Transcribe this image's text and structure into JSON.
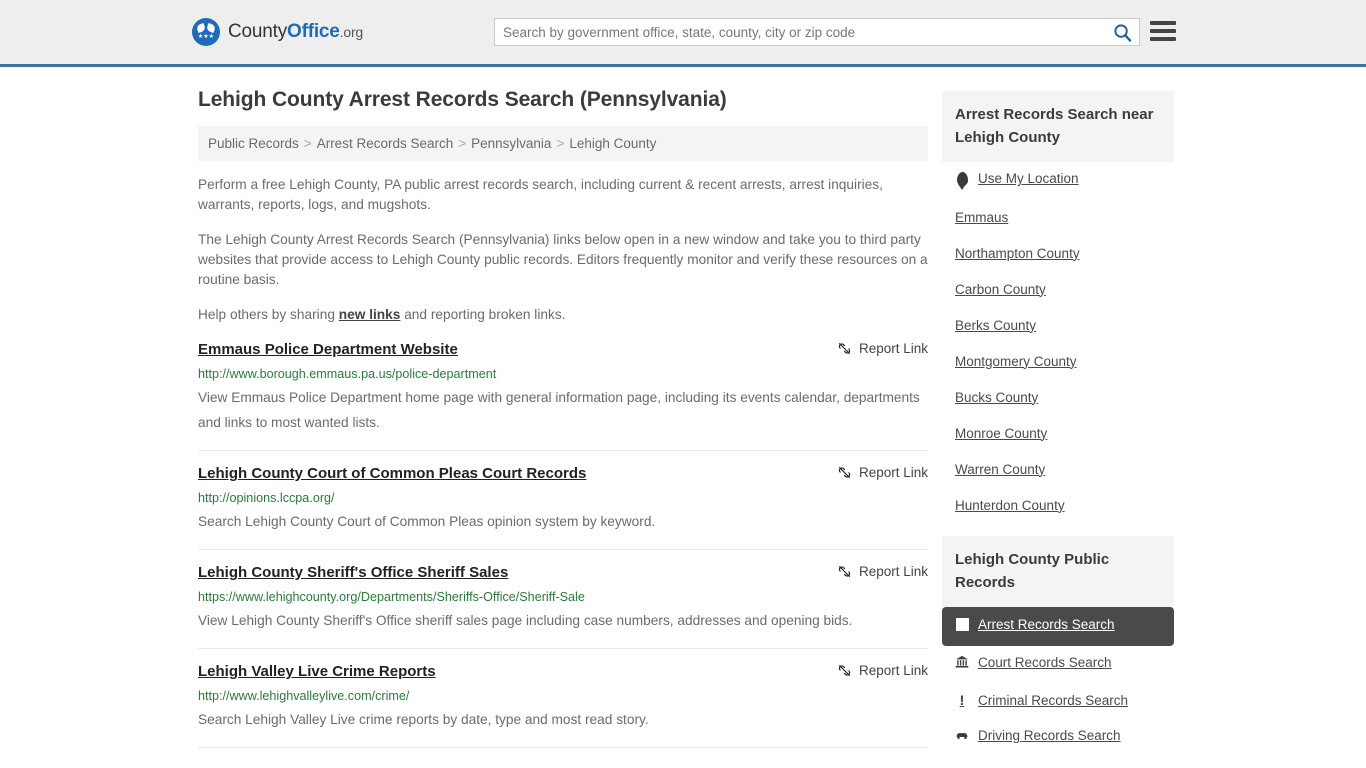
{
  "header": {
    "brand": {
      "part1": "County",
      "part2": "Office",
      "suffix": ".org"
    },
    "search": {
      "placeholder": "Search by government office, state, county, city or zip code",
      "value": ""
    },
    "search_icon": "search-icon",
    "menu_icon": "hamburger-menu-icon"
  },
  "page_title": "Lehigh County Arrest Records Search (Pennsylvania)",
  "breadcrumb": {
    "separator": ">",
    "items": [
      {
        "label": "Public Records"
      },
      {
        "label": "Arrest Records Search"
      },
      {
        "label": "Pennsylvania"
      },
      {
        "label": "Lehigh County"
      }
    ]
  },
  "intro": {
    "p1": "Perform a free Lehigh County, PA public arrest records search, including current & recent arrests, arrest inquiries, warrants, reports, logs, and mugshots.",
    "p2": "The Lehigh County Arrest Records Search (Pennsylvania) links below open in a new window and take you to third party websites that provide access to Lehigh County public records. Editors frequently monitor and verify these resources on a routine basis.",
    "p3_before": "Help others by sharing ",
    "p3_link": "new links",
    "p3_after": " and reporting broken links."
  },
  "report_link_label": "Report Link",
  "report_link_icon": "broken-link-icon",
  "results": [
    {
      "title": "Emmaus Police Department Website",
      "url": "http://www.borough.emmaus.pa.us/police-department",
      "description": "View Emmaus Police Department home page with general information page, including its events calendar, departments and links to most wanted lists."
    },
    {
      "title": "Lehigh County Court of Common Pleas Court Records",
      "url": "http://opinions.lccpa.org/",
      "description": "Search Lehigh County Court of Common Pleas opinion system by keyword."
    },
    {
      "title": "Lehigh County Sheriff's Office Sheriff Sales",
      "url": "https://www.lehighcounty.org/Departments/Sheriffs-Office/Sheriff-Sale",
      "description": "View Lehigh County Sheriff's Office sheriff sales page including case numbers, addresses and opening bids."
    },
    {
      "title": "Lehigh Valley Live Crime Reports",
      "url": "http://www.lehighvalleylive.com/crime/",
      "description": "Search Lehigh Valley Live crime reports by date, type and most read story."
    }
  ],
  "sidebar": {
    "nearby": {
      "heading": "Arrest Records Search near Lehigh County",
      "items": [
        {
          "label": "Use My Location",
          "icon": "map-pin-icon"
        },
        {
          "label": "Emmaus",
          "icon": ""
        },
        {
          "label": "Northampton County",
          "icon": ""
        },
        {
          "label": "Carbon County",
          "icon": ""
        },
        {
          "label": "Berks County",
          "icon": ""
        },
        {
          "label": "Montgomery County",
          "icon": ""
        },
        {
          "label": "Bucks County",
          "icon": ""
        },
        {
          "label": "Monroe County",
          "icon": ""
        },
        {
          "label": "Warren County",
          "icon": ""
        },
        {
          "label": "Hunterdon County",
          "icon": ""
        }
      ]
    },
    "public_records": {
      "heading": "Lehigh County Public Records",
      "items": [
        {
          "label": "Arrest Records Search",
          "icon": "fingerprint-square-icon",
          "active": true
        },
        {
          "label": "Court Records Search",
          "icon": "courthouse-icon",
          "active": false
        },
        {
          "label": "Criminal Records Search",
          "icon": "exclamation-icon",
          "active": false
        },
        {
          "label": "Driving Records Search",
          "icon": "car-icon",
          "active": false
        }
      ]
    }
  },
  "colors": {
    "header_bg": "#eeeeee",
    "header_border": "#3b74a8",
    "brand_blue": "#1f6bb5",
    "url_green": "#2a7a3b",
    "panel_bg": "#f4f4f4",
    "active_bg": "#4a4a4a"
  }
}
